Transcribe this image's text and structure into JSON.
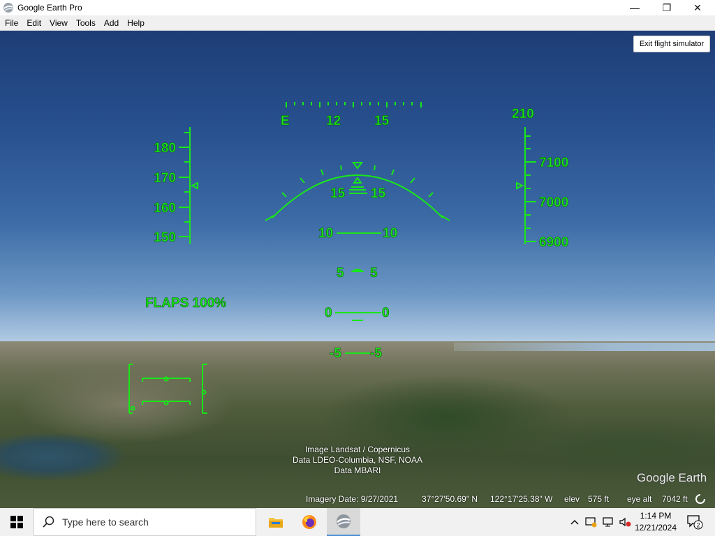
{
  "window": {
    "title": "Google Earth Pro",
    "controls": [
      "—",
      "❐",
      "✕"
    ]
  },
  "menu": [
    {
      "label": "File",
      "key": "F"
    },
    {
      "label": "Edit",
      "key": "E"
    },
    {
      "label": "View",
      "key": "V"
    },
    {
      "label": "Tools",
      "key": "T"
    },
    {
      "label": "Add",
      "key": "A"
    },
    {
      "label": "Help",
      "key": "H"
    }
  ],
  "exit_button": "Exit flight simulator",
  "hud": {
    "color": "#19e619",
    "heading_labels": [
      "E",
      "12",
      "15"
    ],
    "speed_labels": [
      "180",
      "170",
      "160",
      "150"
    ],
    "altitude_top": "210",
    "altitude_labels": [
      "7100",
      "7000",
      "6900"
    ],
    "pitch_labels": [
      "15",
      "10",
      "5",
      "0",
      "-5"
    ],
    "flaps": "FLAPS 100%"
  },
  "attribution": [
    "Image Landsat / Copernicus",
    "Data LDEO-Columbia, NSF, NOAA",
    "Data MBARI"
  ],
  "logo": "Google Earth",
  "status": {
    "imagery_date": "Imagery Date: 9/27/2021",
    "lat": "37°27'50.69\" N",
    "lon": "122°17'25.38\" W",
    "elev_label": "elev",
    "elev_value": "575 ft",
    "eye_label": "eye alt",
    "eye_value": "7042 ft"
  },
  "taskbar": {
    "search_placeholder": "Type here to search",
    "time": "1:14 PM",
    "date": "12/21/2024",
    "notification_count": "2"
  }
}
